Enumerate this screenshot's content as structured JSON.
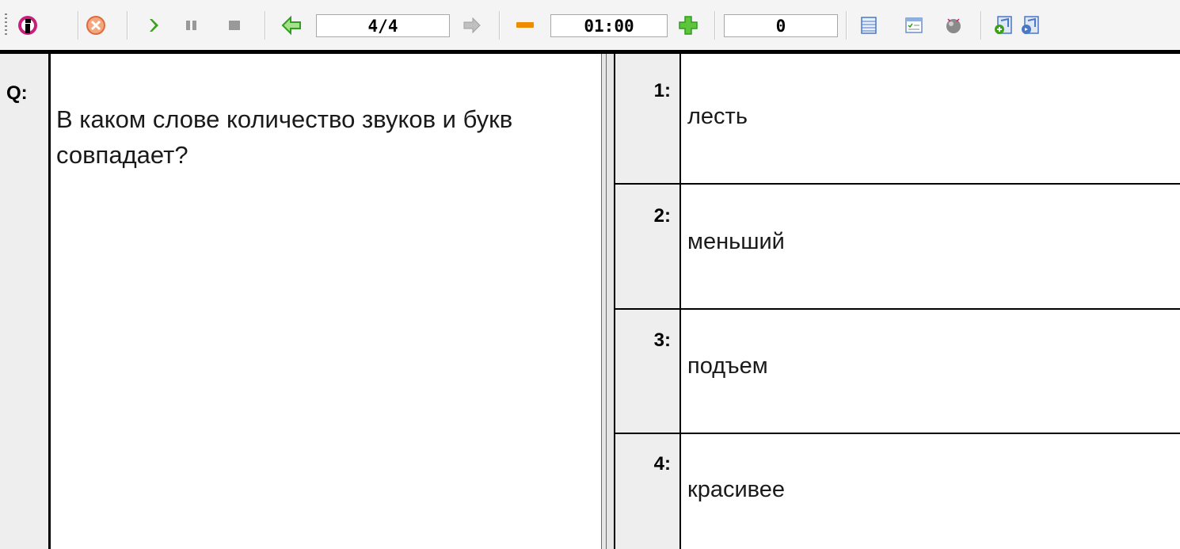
{
  "toolbar": {
    "slide_counter": "4/4",
    "timer": "01:00",
    "score": "0",
    "icons": [
      "info-icon",
      "close-circle-icon",
      "play-icon",
      "pause-icon",
      "stop-icon",
      "arrow-left-icon",
      "arrow-right-icon",
      "minus-icon",
      "plus-icon",
      "table-icon",
      "form-icon",
      "record-icon",
      "add-sound-icon",
      "sound-icon"
    ],
    "colors": {
      "play": "#3aa11a",
      "close": "#e06a3a",
      "info": "#c8207a",
      "minus": "#f08a00",
      "plus": "#2f9e1f",
      "arrow_left": "#2f9e1f",
      "arrow_right": "#a0a0a0"
    }
  },
  "question": {
    "label": "Q:",
    "text": "В каком слове количество звуков и букв совпадает?"
  },
  "answers": [
    {
      "number": "1:",
      "text": "лесть"
    },
    {
      "number": "2:",
      "text": "меньший"
    },
    {
      "number": "3:",
      "text": "подъем"
    },
    {
      "number": "4:",
      "text": "красивее"
    }
  ]
}
